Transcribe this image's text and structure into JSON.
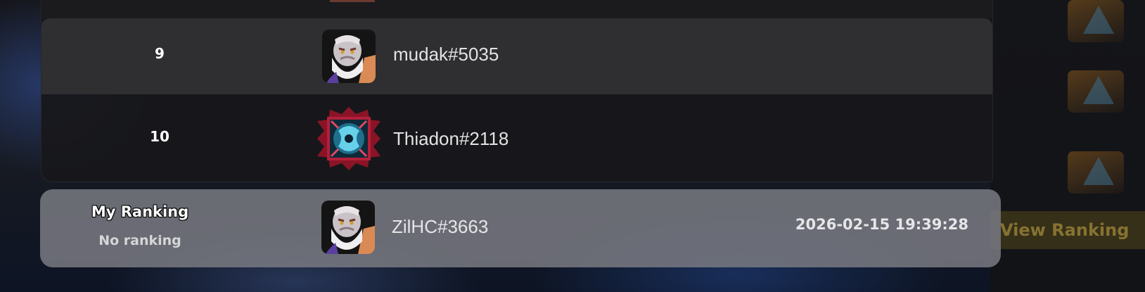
{
  "leaderboard": {
    "rows": [
      {
        "rank": "9",
        "player": "mudak#5035",
        "avatar_icon": "bearded-warrior-portrait-icon"
      },
      {
        "rank": "10",
        "player": "Thiadon#2118",
        "avatar_icon": "spiked-crimson-frame-emblem-icon"
      }
    ]
  },
  "my_ranking": {
    "label": "My Ranking",
    "status": "No ranking",
    "player": "ZilHC#3663",
    "avatar_icon": "bearded-warrior-portrait-icon",
    "timestamp": "2026-02-15 19:39:28"
  },
  "background": {
    "view_ranking_label": "View Ranking"
  },
  "colors": {
    "row_highlight": "#2f2f32",
    "table_bg": "#18181b",
    "my_bar": "#76787f",
    "text_primary": "#ffffff"
  }
}
